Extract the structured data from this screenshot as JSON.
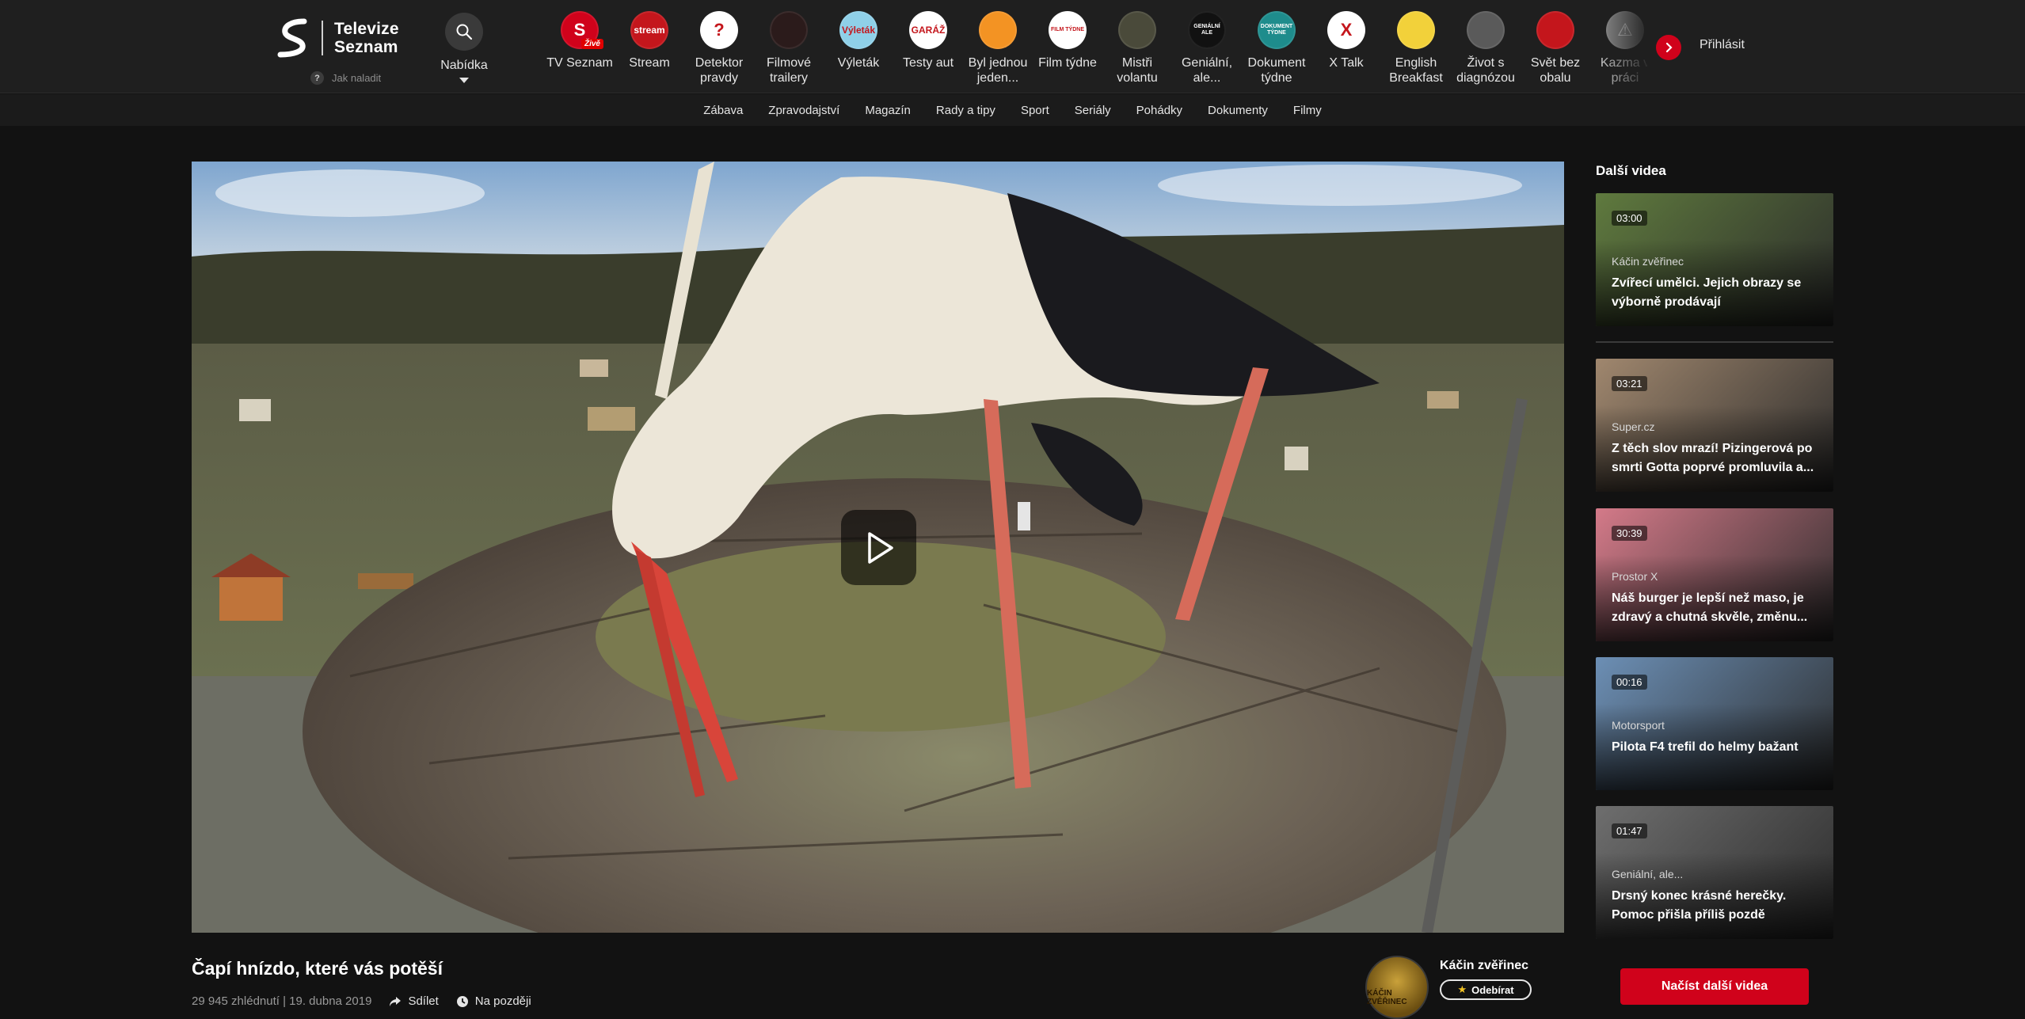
{
  "header": {
    "logo_line1": "Televize",
    "logo_line2": "Seznam",
    "howto_label": "Jak naladit",
    "menu_label": "Nabídka",
    "login_label": "Přihlásit",
    "channels": [
      {
        "label": "TV Seznam",
        "icon": "tv-seznam-icon",
        "color": "#d0021b",
        "glyph": "S",
        "badge": "Živě"
      },
      {
        "label": "Stream",
        "icon": "stream-icon",
        "color": "#c4161c",
        "glyph": "stream"
      },
      {
        "label": "Detektor pravdy",
        "icon": "question-icon",
        "color": "#ffffff",
        "glyph": "?"
      },
      {
        "label": "Filmové trailery",
        "icon": "film-trailers-icon",
        "color": "#2b1b1b",
        "glyph": ""
      },
      {
        "label": "Výleták",
        "icon": "trip-icon",
        "color": "#8fd0e8",
        "glyph": "Výleták"
      },
      {
        "label": "Testy aut",
        "icon": "garage-icon",
        "color": "#ffffff",
        "glyph": "GARÁŽ"
      },
      {
        "label": "Byl jednou jeden...",
        "icon": "cartoon-icon",
        "color": "#f39323",
        "glyph": ""
      },
      {
        "label": "Film týdne",
        "icon": "film-week-icon",
        "color": "#ffffff",
        "glyph": "FILM TÝDNE"
      },
      {
        "label": "Mistři volantu",
        "icon": "steering-icon",
        "color": "#4a4a3a",
        "glyph": ""
      },
      {
        "label": "Geniální, ale...",
        "icon": "genius-icon",
        "color": "#111111",
        "glyph": "GENIÁLNÍ ALE"
      },
      {
        "label": "Dokument týdne",
        "icon": "document-week-icon",
        "color": "#1e8c8c",
        "glyph": "DOKUMENT TÝDNE"
      },
      {
        "label": "X Talk",
        "icon": "x-talk-icon",
        "color": "#ffffff",
        "glyph": "X"
      },
      {
        "label": "English Breakfast",
        "icon": "english-breakfast-icon",
        "color": "#f2d13a",
        "glyph": ""
      },
      {
        "label": "Život s diagnózou",
        "icon": "diagnosis-icon",
        "color": "#5a5a5a",
        "glyph": ""
      },
      {
        "label": "Svět bez obalu",
        "icon": "world-icon",
        "color": "#c4161c",
        "glyph": ""
      },
      {
        "label": "Kazma v práci",
        "icon": "kazma-icon",
        "color": "#9a9a9a",
        "glyph": "⚠"
      }
    ]
  },
  "categories": [
    "Zábava",
    "Zpravodajství",
    "Magazín",
    "Rady a tipy",
    "Sport",
    "Seriály",
    "Pohádky",
    "Dokumenty",
    "Filmy"
  ],
  "video": {
    "title": "Čapí hnízdo, které vás potěší",
    "views": "29 945 zhlédnutí | 19. dubna 2019",
    "share_label": "Sdílet",
    "later_label": "Na později"
  },
  "channel": {
    "name": "Káčin zvěřinec",
    "avatar_text": "KÁČIN ZVĚŘINEC",
    "subscribe_label": "Odebírat"
  },
  "sidebar": {
    "title": "Další videa",
    "load_more_label": "Načíst další videa",
    "videos": [
      {
        "duration": "03:00",
        "source": "Káčin zvěřinec",
        "title": "Zvířecí umělci. Jejich obrazy se výborně prodávají",
        "color": "#5f7a3e"
      },
      {
        "duration": "03:21",
        "source": "Super.cz",
        "title": "Z těch slov mrazí! Pizingerová po smrti Gotta poprvé promluvila a...",
        "color": "#a0876e"
      },
      {
        "duration": "30:39",
        "source": "Prostor X",
        "title": "Náš burger je lepší než maso, je zdravý a chutná skvěle, změnu...",
        "color": "#d47a89"
      },
      {
        "duration": "00:16",
        "source": "Motorsport",
        "title": "Pilota F4 trefil do helmy bažant",
        "color": "#6c8fb5"
      },
      {
        "duration": "01:47",
        "source": "Geniální, ale...",
        "title": "Drsný konec krásné herečky. Pomoc přišla příliš pozdě",
        "color": "#6e6e6e"
      }
    ]
  }
}
